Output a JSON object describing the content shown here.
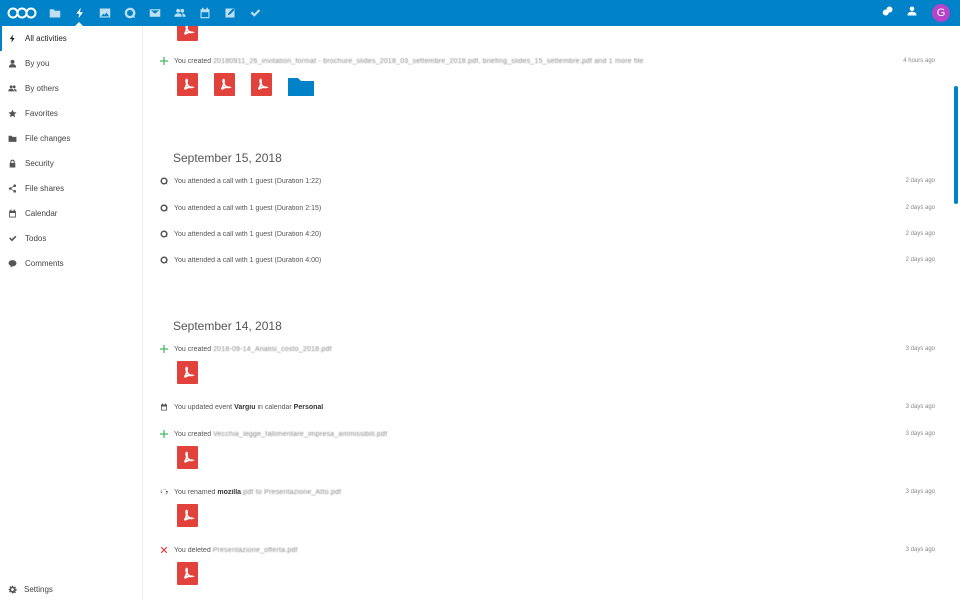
{
  "header": {
    "apps": [
      "files-icon",
      "activity-icon",
      "gallery-icon",
      "talk-icon",
      "mail-icon",
      "contacts-icon",
      "calendar-icon",
      "notes-icon",
      "tasks-icon"
    ],
    "avatar_letter": "G"
  },
  "sidebar": {
    "items": [
      {
        "label": "All activities",
        "icon": "bolt-icon"
      },
      {
        "label": "By you",
        "icon": "user-icon"
      },
      {
        "label": "By others",
        "icon": "users-icon"
      },
      {
        "label": "Favorites",
        "icon": "star-icon"
      },
      {
        "label": "File changes",
        "icon": "folder-icon"
      },
      {
        "label": "Security",
        "icon": "lock-icon"
      },
      {
        "label": "File shares",
        "icon": "share-icon"
      },
      {
        "label": "Calendar",
        "icon": "calendar-icon"
      },
      {
        "label": "Todos",
        "icon": "check-icon"
      },
      {
        "label": "Comments",
        "icon": "comment-icon"
      }
    ],
    "settings_label": "Settings"
  },
  "activities": {
    "top": {
      "prefix": "You created",
      "blurred": "20180911_26_invitation_format - brochure_slides_2018_03_settembre_2018.pdf, briefing_slides_15_settembre.pdf and 1 more file",
      "time": "4 hours ago"
    },
    "day1": {
      "heading": "September 15, 2018",
      "items": [
        {
          "text": "You attended a call with 1 guest (Duration 1:22)",
          "time": "2 days ago"
        },
        {
          "text": "You attended a call with 1 guest (Duration 2:15)",
          "time": "2 days ago"
        },
        {
          "text": "You attended a call with 1 guest (Duration 4:20)",
          "time": "2 days ago"
        },
        {
          "text": "You attended a call with 1 guest (Duration 4:00)",
          "time": "2 days ago"
        }
      ]
    },
    "day2": {
      "heading": "September 14, 2018",
      "created1": {
        "prefix": "You created",
        "blurred": "2018-09-14_Analisi_costo_2018.pdf",
        "time": "3 days ago"
      },
      "updated": {
        "prefix": "You updated event",
        "event": "Vargiu",
        "middle": "in calendar",
        "calendar": "Personal",
        "time": "3 days ago"
      },
      "created2": {
        "prefix": "You created",
        "blurred": "Vecchia_legge_fallimentare_impresa_ammissibili.pdf",
        "time": "3 days ago"
      },
      "renamed": {
        "prefix": "You renamed",
        "from": "mozilla",
        "blurred": ".pdf to Presentazione_Atto.pdf",
        "time": "3 days ago"
      },
      "deleted": {
        "prefix": "You deleted",
        "blurred": "Presentazione_offerta.pdf",
        "time": "3 days ago"
      }
    }
  },
  "colors": {
    "brand": "#0082c9",
    "pdf": "#e2423c",
    "create": "#46ba61",
    "delete": "#e9322d"
  }
}
